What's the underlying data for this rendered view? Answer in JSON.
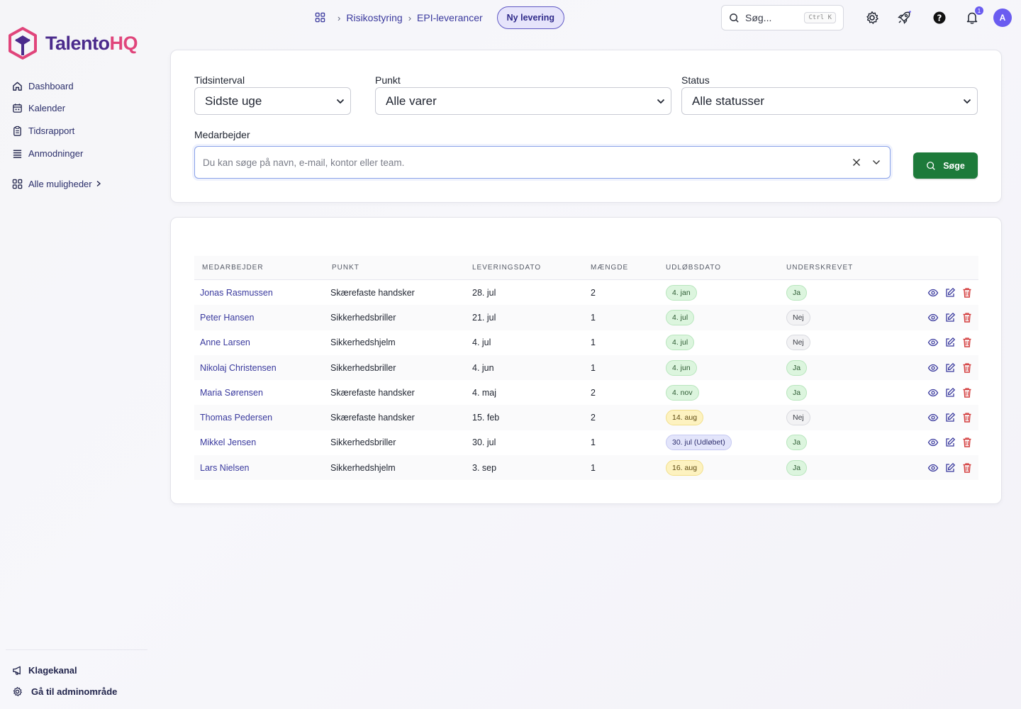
{
  "brand": {
    "part1": "Talento",
    "part2": "HQ"
  },
  "sidebar": {
    "items": [
      {
        "label": "Dashboard",
        "icon": "home-icon"
      },
      {
        "label": "Kalender",
        "icon": "calendar-icon"
      },
      {
        "label": "Tidsrapport",
        "icon": "clipboard-icon"
      },
      {
        "label": "Anmodninger",
        "icon": "list-icon"
      }
    ],
    "all_options": "Alle muligheder",
    "bottom": [
      {
        "label": "Klagekanal",
        "icon": "megaphone-icon"
      },
      {
        "label": "Gå til adminområde",
        "icon": "gear-icon"
      }
    ]
  },
  "breadcrumb": {
    "items": [
      "Risikostyring",
      "EPI-leverancer"
    ],
    "new_button": "Ny levering"
  },
  "header": {
    "search_label": "Søg...",
    "shortcut": "Ctrl K",
    "notifications_count": "1",
    "avatar_initial": "A"
  },
  "filters": {
    "period": {
      "label": "Tidsinterval",
      "value": "Sidste uge"
    },
    "item": {
      "label": "Punkt",
      "value": "Alle varer"
    },
    "status": {
      "label": "Status",
      "value": "Alle statusser"
    },
    "employee": {
      "label": "Medarbejder",
      "placeholder": "Du kan søge på navn, e-mail, kontor eller team."
    },
    "search_button": "Søge"
  },
  "table": {
    "columns": [
      "MEDARBEJDER",
      "PUNKT",
      "LEVERINGSDATO",
      "MÆNGDE",
      "UDLØBSDATO",
      "UNDERSKREVET"
    ],
    "rows": [
      {
        "employee": "Jonas Rasmussen",
        "item": "Skærefaste handsker",
        "delivery": "28. jul",
        "qty": "2",
        "expiry": "4. jan",
        "expiry_status": "green",
        "signed": "Ja"
      },
      {
        "employee": "Peter Hansen",
        "item": "Sikkerhedsbriller",
        "delivery": "21. jul",
        "qty": "1",
        "expiry": "4. jul",
        "expiry_status": "green",
        "signed": "Nej"
      },
      {
        "employee": "Anne Larsen",
        "item": "Sikkerhedshjelm",
        "delivery": "4. jul",
        "qty": "1",
        "expiry": "4. jul",
        "expiry_status": "green",
        "signed": "Nej"
      },
      {
        "employee": "Nikolaj Christensen",
        "item": "Sikkerhedsbriller",
        "delivery": "4. jun",
        "qty": "1",
        "expiry": "4. jun",
        "expiry_status": "green",
        "signed": "Ja"
      },
      {
        "employee": "Maria Sørensen",
        "item": "Skærefaste handsker",
        "delivery": "4. maj",
        "qty": "2",
        "expiry": "4. nov",
        "expiry_status": "green",
        "signed": "Ja"
      },
      {
        "employee": "Thomas Pedersen",
        "item": "Skærefaste handsker",
        "delivery": "15. feb",
        "qty": "2",
        "expiry": "14. aug",
        "expiry_status": "yellow",
        "signed": "Nej"
      },
      {
        "employee": "Mikkel Jensen",
        "item": "Sikkerhedsbriller",
        "delivery": "30. jul",
        "qty": "1",
        "expiry": "30. jul (Udløbet)",
        "expiry_status": "blue",
        "signed": "Ja"
      },
      {
        "employee": "Lars Nielsen",
        "item": "Sikkerhedshjelm",
        "delivery": "3. sep",
        "qty": "1",
        "expiry": "16. aug",
        "expiry_status": "yellow",
        "signed": "Ja"
      }
    ]
  },
  "colors": {
    "accent": "#6a5cf0",
    "link": "#3a3a9e",
    "primary_button": "#1d7a3a",
    "danger": "#d33a3a"
  }
}
